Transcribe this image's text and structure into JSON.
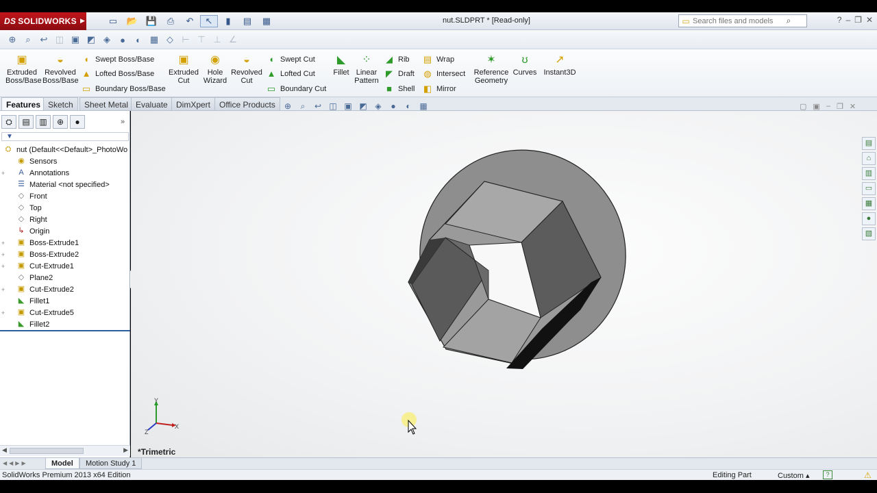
{
  "app": {
    "logo": "SOLIDWORKS",
    "document_title": "nut.SLDPRT * [Read-only]",
    "search_placeholder": "Search files and models"
  },
  "ribbon": {
    "extruded_boss": "Extruded\nBoss/Base",
    "revolved_boss": "Revolved\nBoss/Base",
    "swept_boss": "Swept Boss/Base",
    "lofted_boss": "Lofted Boss/Base",
    "boundary_boss": "Boundary Boss/Base",
    "extruded_cut": "Extruded\nCut",
    "hole_wizard": "Hole\nWizard",
    "revolved_cut": "Revolved\nCut",
    "swept_cut": "Swept Cut",
    "lofted_cut": "Lofted Cut",
    "boundary_cut": "Boundary Cut",
    "fillet": "Fillet",
    "linear_pattern": "Linear\nPattern",
    "rib": "Rib",
    "draft": "Draft",
    "shell": "Shell",
    "wrap": "Wrap",
    "intersect": "Intersect",
    "mirror": "Mirror",
    "reference_geometry": "Reference\nGeometry",
    "curves": "Curves",
    "instant3d": "Instant3D"
  },
  "tabs": [
    "Features",
    "Sketch",
    "Sheet Metal",
    "Evaluate",
    "DimXpert",
    "Office Products"
  ],
  "tree": {
    "root": "nut  (Default<<Default>_PhotoWo",
    "items": [
      "Sensors",
      "Annotations",
      "Material <not specified>",
      "Front",
      "Top",
      "Right",
      "Origin",
      "Boss-Extrude1",
      "Boss-Extrude2",
      "Cut-Extrude1",
      "Plane2",
      "Cut-Extrude2",
      "Fillet1",
      "Cut-Extrude5",
      "Fillet2"
    ]
  },
  "viewport": {
    "view_name": "*Trimetric",
    "triad_labels": [
      "Y",
      "X",
      "Z"
    ]
  },
  "bottom_tabs": [
    "Model",
    "Motion Study 1"
  ],
  "status": {
    "edition": "SolidWorks Premium 2013 x64 Edition",
    "mode": "Editing Part",
    "units": "Custom"
  },
  "colors": {
    "logo_red": "#b5121b",
    "part_gray": "#8c8c8c",
    "viewport_bg": "#f3f4f5"
  }
}
